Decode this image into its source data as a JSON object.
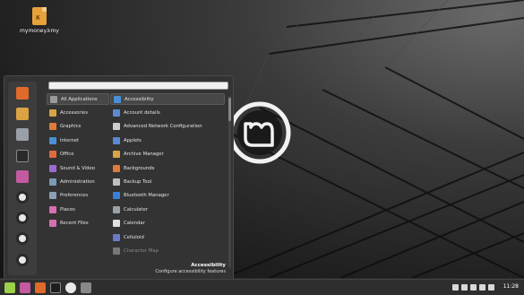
{
  "desktop": {
    "file_label": "mymoney.kmy",
    "file_badge": "₭"
  },
  "menu": {
    "search_placeholder": "",
    "categories": [
      {
        "label": "All Applications",
        "icon": "grid-icon",
        "color": "#9a9a9a",
        "selected": true
      },
      {
        "label": "Accessories",
        "icon": "accessories-icon",
        "color": "#d9a441"
      },
      {
        "label": "Graphics",
        "icon": "graphics-icon",
        "color": "#e07b3a"
      },
      {
        "label": "Internet",
        "icon": "internet-icon",
        "color": "#4a8fd6"
      },
      {
        "label": "Office",
        "icon": "office-icon",
        "color": "#e06a3a"
      },
      {
        "label": "Sound & Video",
        "icon": "sound-video-icon",
        "color": "#9b6bd0"
      },
      {
        "label": "Administration",
        "icon": "administration-icon",
        "color": "#7a9ab8"
      },
      {
        "label": "Preferences",
        "icon": "preferences-icon",
        "color": "#8aa0b8"
      },
      {
        "label": "Places",
        "icon": "places-folder-icon",
        "color": "#d86fb0"
      },
      {
        "label": "Recent Files",
        "icon": "recent-files-icon",
        "color": "#d86fb0"
      }
    ],
    "apps": [
      {
        "label": "Accessibility",
        "icon": "accessibility-icon",
        "color": "#4a8fd6",
        "selected": true
      },
      {
        "label": "Account details",
        "icon": "account-icon",
        "color": "#5b8ad0"
      },
      {
        "label": "Advanced Network Configuration",
        "icon": "network-icon",
        "color": "#cfcfcf"
      },
      {
        "label": "Applets",
        "icon": "applets-icon",
        "color": "#5b8ad0"
      },
      {
        "label": "Archive Manager",
        "icon": "archive-icon",
        "color": "#d9a441"
      },
      {
        "label": "Backgrounds",
        "icon": "backgrounds-icon",
        "color": "#e07b3a"
      },
      {
        "label": "Backup Tool",
        "icon": "backup-icon",
        "color": "#bfbfbf"
      },
      {
        "label": "Bluetooth Manager",
        "icon": "bluetooth-icon",
        "color": "#3a7fd6"
      },
      {
        "label": "Calculator",
        "icon": "calculator-icon",
        "color": "#9aa0a8"
      },
      {
        "label": "Calendar",
        "icon": "calendar-icon",
        "color": "#e0e0e0"
      },
      {
        "label": "Celluloid",
        "icon": "celluloid-icon",
        "color": "#6a7ac8"
      },
      {
        "label": "Character Map",
        "icon": "character-map-icon",
        "color": "#777777",
        "dim": true
      }
    ],
    "description": {
      "title": "Accessibility",
      "text": "Configure accessibility features"
    },
    "favorites": [
      {
        "icon": "firefox-icon",
        "color": "#e06a2a"
      },
      {
        "icon": "software-manager-icon",
        "color": "#d9a441"
      },
      {
        "icon": "settings-icon",
        "color": "#9aa0a8"
      },
      {
        "icon": "terminal-icon",
        "color": "#2a2a2a"
      },
      {
        "icon": "files-icon",
        "color": "#c45aa0"
      },
      {
        "icon": "lock-screen-icon",
        "color": "#e8e8e8"
      },
      {
        "icon": "logout-icon",
        "color": "#e8e8e8"
      },
      {
        "icon": "power-icon",
        "color": "#e8e8e8"
      },
      {
        "icon": "shutdown-icon",
        "color": "#e8e8e8"
      }
    ]
  },
  "taskbar": {
    "clock": "11:28",
    "launchers": [
      {
        "icon": "mint-menu-icon"
      },
      {
        "icon": "files-icon"
      },
      {
        "icon": "firefox-icon"
      },
      {
        "icon": "terminal-icon"
      },
      {
        "icon": "record-icon"
      },
      {
        "icon": "window-icon"
      }
    ],
    "tray": [
      {
        "icon": "update-shield-icon"
      },
      {
        "icon": "network-icon"
      },
      {
        "icon": "volume-icon"
      },
      {
        "icon": "wifi-icon"
      },
      {
        "icon": "power-tray-icon"
      }
    ]
  }
}
